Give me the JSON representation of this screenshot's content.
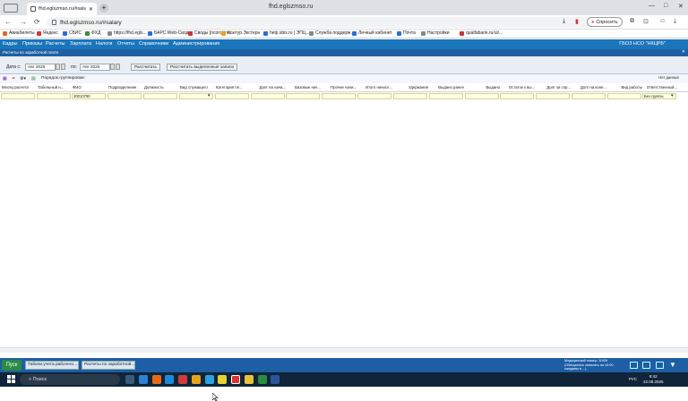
{
  "browser": {
    "tab_title": "fhd.eglszmso.ru/#salu",
    "window_title": "fhd.eglszmso.ru",
    "address": "fhd.eglszmso.ru/#salary",
    "reco_label": "Спросить",
    "bookmarks": [
      "Авиабилеты",
      "Яндекс",
      "СБИС",
      "ФХД",
      "https://fhd.egls...",
      "БАРС.Web-Свод...",
      "Своды [ncorokino...",
      "Контур.Экстерн",
      "help.sbis.ru | ЭПЦ...",
      "Служба поддерж...",
      "Личный кабинет",
      "Почта",
      "Настройки",
      "qualfabank.ru/ul/..."
    ]
  },
  "app": {
    "menu": [
      "Кадры",
      "Приказы",
      "Расчеты",
      "Зарплата",
      "Налоги",
      "Отчеты",
      "Справочники",
      "Администрирование"
    ],
    "org": "ГБОЗ НСО \"НКЦРБ\"",
    "panel_title": "Расчеты по заработной плате",
    "date_from_label": "Дата с:",
    "date_from": "Авг 2025",
    "date_to_label": "по:",
    "date_to": "Авг 2025",
    "calc_button": "Рассчитать",
    "calc_selected_button": "Рассчитать выделенные записи",
    "grouping_label": "Порядок группировки:",
    "no_data": "Нет данных",
    "columns": [
      "Месяц расчета",
      "Табельный н...",
      "ФИО",
      "Подразделение",
      "Должность",
      "Вид служащего",
      "Категория пе...",
      "Долг на нача...",
      "Базовые нач...",
      "Прочие начи...",
      "Итого начисл...",
      "Удержания",
      "Выдано ранее",
      "Выдано",
      "Остаток к вы...",
      "Долг за спр...",
      "Долг на коне...",
      "Вид работы",
      "Ответственный..."
    ],
    "filter_fio": "30010790",
    "filter_responsible": "Без группы"
  },
  "taskbar": {
    "start": "Пуск",
    "tasks": [
      "Табели учета рабочего...",
      "Расчеты по заработной..."
    ],
    "status": "Медицинский номер: 11926 (Обещалось записать на 10:00, ожидаем в ...)"
  },
  "windows": {
    "search_placeholder": "Поиск",
    "time": "8:42",
    "date": "22.08.2025",
    "lang": "РУС"
  }
}
